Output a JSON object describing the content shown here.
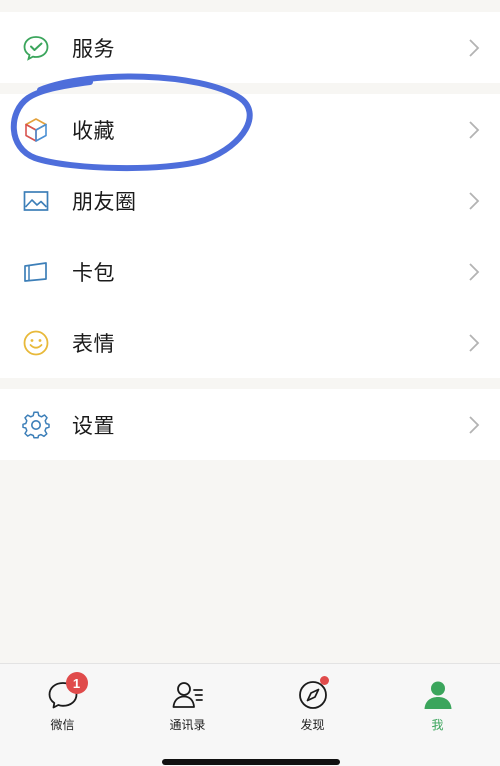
{
  "menu": {
    "services": {
      "label": "服务",
      "icon": "wechat-pay-icon"
    },
    "favorites": {
      "label": "收藏",
      "icon": "cube-icon"
    },
    "moments": {
      "label": "朋友圈",
      "icon": "image-icon"
    },
    "cards": {
      "label": "卡包",
      "icon": "card-wallet-icon"
    },
    "stickers": {
      "label": "表情",
      "icon": "smiley-icon"
    },
    "settings": {
      "label": "设置",
      "icon": "gear-icon"
    }
  },
  "tabbar": {
    "tabs": [
      {
        "label": "微信",
        "icon": "chat-bubble-icon",
        "badge": "1"
      },
      {
        "label": "通讯录",
        "icon": "contacts-icon"
      },
      {
        "label": "发现",
        "icon": "compass-icon"
      },
      {
        "label": "我",
        "icon": "person-icon"
      }
    ],
    "active": "我"
  },
  "colors": {
    "accent_green": "#3ba55c",
    "badge_red": "#e04b4b",
    "annotation_blue": "#3f62d8",
    "page_bg": "#f7f6f3"
  }
}
